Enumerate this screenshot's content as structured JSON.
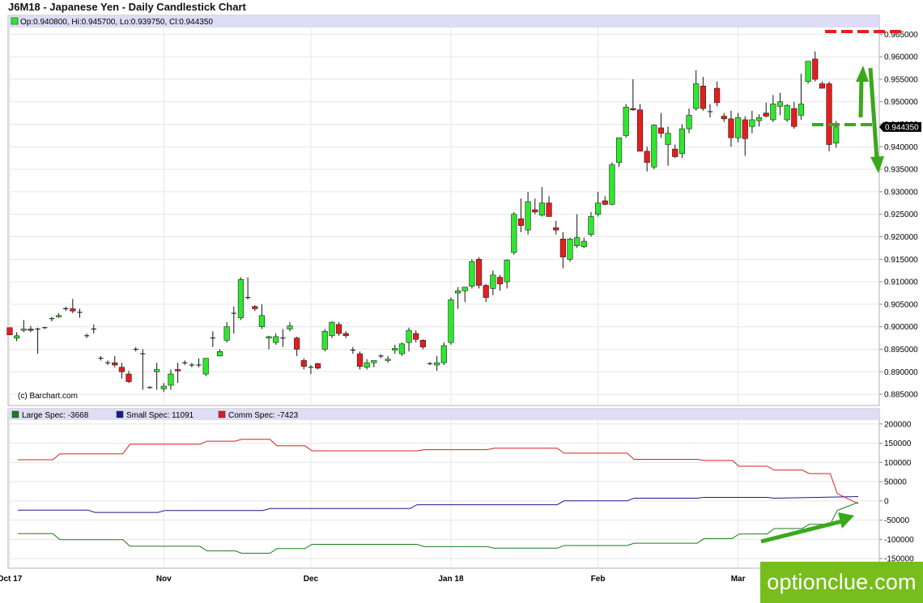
{
  "header": {
    "title": "J6M18 - Japanese Yen - Daily Candlestick Chart",
    "ohlc": "Op:0.940800, Hi:0.945700, Lo:0.939750, Cl:0.944350",
    "credit": "(c) Barchart.com",
    "last_price": "0.944350"
  },
  "watermark": {
    "text": "optionclue.com",
    "color": "#78bd1e"
  },
  "colors": {
    "up": "#2ee82e",
    "down": "#e51d1d",
    "large_spec": "#1c7a1c",
    "small_spec": "#1a1a8c",
    "comm_spec": "#d42020",
    "annotation_green": "#3aa81c",
    "annotation_red": "#e02020"
  },
  "chart_data": [
    {
      "type": "candlestick",
      "title": "J6M18 - Japanese Yen - Daily Candlestick Chart",
      "ylim": [
        0.8825,
        0.9665
      ],
      "yticks": [
        "0.965000",
        "0.960000",
        "0.955000",
        "0.950000",
        "0.945000",
        "0.940000",
        "0.935000",
        "0.930000",
        "0.925000",
        "0.920000",
        "0.915000",
        "0.910000",
        "0.905000",
        "0.900000",
        "0.895000",
        "0.890000",
        "0.885000"
      ],
      "xticks": [
        {
          "label": "Oct 17",
          "i": 0
        },
        {
          "label": "Nov",
          "i": 22
        },
        {
          "label": "Dec",
          "i": 43
        },
        {
          "label": "Jan 18",
          "i": 63
        },
        {
          "label": "Feb",
          "i": 84
        },
        {
          "label": "Mar",
          "i": 104
        }
      ],
      "candles": [
        [
          0.8998,
          0.8998,
          0.8982,
          0.8982
        ],
        [
          0.8975,
          0.8988,
          0.8968,
          0.898
        ],
        [
          0.8992,
          0.9015,
          0.8988,
          0.8995
        ],
        [
          0.8995,
          0.9002,
          0.8988,
          0.8992
        ],
        [
          0.8995,
          0.8998,
          0.894,
          0.8995
        ],
        [
          0.8998,
          0.9,
          0.8995,
          0.8998
        ],
        [
          0.9018,
          0.9022,
          0.9012,
          0.9018
        ],
        [
          0.9022,
          0.903,
          0.902,
          0.9025
        ],
        [
          0.904,
          0.9045,
          0.9035,
          0.9038
        ],
        [
          0.904,
          0.9062,
          0.903,
          0.9035
        ],
        [
          0.9032,
          0.904,
          0.902,
          0.9032
        ],
        [
          0.898,
          0.8985,
          0.8975,
          0.8978
        ],
        [
          0.8995,
          0.9005,
          0.8985,
          0.8995
        ],
        [
          0.893,
          0.8935,
          0.8925,
          0.893
        ],
        [
          0.892,
          0.8925,
          0.8915,
          0.892
        ],
        [
          0.892,
          0.8935,
          0.891,
          0.8915
        ],
        [
          0.891,
          0.892,
          0.8885,
          0.89
        ],
        [
          0.8895,
          0.8902,
          0.8875,
          0.8878
        ],
        [
          0.895,
          0.8955,
          0.8945,
          0.895
        ],
        [
          0.894,
          0.895,
          0.886,
          0.894
        ],
        [
          0.8865,
          0.8868,
          0.8862,
          0.8865
        ],
        [
          0.89,
          0.892,
          0.886,
          0.8905
        ],
        [
          0.8862,
          0.8875,
          0.8855,
          0.8868
        ],
        [
          0.887,
          0.8905,
          0.886,
          0.8895
        ],
        [
          0.8905,
          0.892,
          0.8875,
          0.8902
        ],
        [
          0.892,
          0.8925,
          0.8915,
          0.892
        ],
        [
          0.8915,
          0.892,
          0.891,
          0.8915
        ],
        [
          0.8915,
          0.893,
          0.891,
          0.8915
        ],
        [
          0.8895,
          0.893,
          0.889,
          0.893
        ],
        [
          0.8975,
          0.899,
          0.8955,
          0.8975
        ],
        [
          0.8935,
          0.895,
          0.8935,
          0.8945
        ],
        [
          0.897,
          0.901,
          0.8965,
          0.9
        ],
        [
          0.903,
          0.9045,
          0.8985,
          0.903
        ],
        [
          0.902,
          0.911,
          0.9015,
          0.9105
        ],
        [
          0.9065,
          0.911,
          0.906,
          0.9065
        ],
        [
          0.9045,
          0.9048,
          0.9035,
          0.904
        ],
        [
          0.9,
          0.905,
          0.8995,
          0.9025
        ],
        [
          0.8975,
          0.898,
          0.895,
          0.8978
        ],
        [
          0.8965,
          0.8985,
          0.896,
          0.8978
        ],
        [
          0.8975,
          0.8995,
          0.8955,
          0.8975
        ],
        [
          0.8995,
          0.901,
          0.899,
          0.9002
        ],
        [
          0.8975,
          0.8978,
          0.8935,
          0.895
        ],
        [
          0.8925,
          0.893,
          0.8905,
          0.8912
        ],
        [
          0.891,
          0.8915,
          0.8895,
          0.891
        ],
        [
          0.8918,
          0.892,
          0.8905,
          0.8908
        ],
        [
          0.895,
          0.8995,
          0.8945,
          0.899
        ],
        [
          0.898,
          0.9012,
          0.8975,
          0.901
        ],
        [
          0.9005,
          0.901,
          0.898,
          0.8985
        ],
        [
          0.8985,
          0.899,
          0.8975,
          0.898
        ],
        [
          0.8948,
          0.8955,
          0.894,
          0.8948
        ],
        [
          0.894,
          0.8945,
          0.8905,
          0.8912
        ],
        [
          0.891,
          0.8928,
          0.8905,
          0.892
        ],
        [
          0.892,
          0.8925,
          0.891,
          0.8925
        ],
        [
          0.8935,
          0.8938,
          0.893,
          0.8935
        ],
        [
          0.8925,
          0.8935,
          0.892,
          0.8928
        ],
        [
          0.8948,
          0.896,
          0.894,
          0.8952
        ],
        [
          0.894,
          0.8965,
          0.8935,
          0.8962
        ],
        [
          0.8965,
          0.8998,
          0.8945,
          0.8992
        ],
        [
          0.8985,
          0.8992,
          0.8965,
          0.8972
        ],
        [
          0.897,
          0.8972,
          0.895,
          0.8955
        ],
        [
          0.8918,
          0.8922,
          0.8915,
          0.8918
        ],
        [
          0.8915,
          0.8935,
          0.8902,
          0.892
        ],
        [
          0.892,
          0.8965,
          0.8915,
          0.8958
        ],
        [
          0.8965,
          0.9065,
          0.896,
          0.906
        ],
        [
          0.9075,
          0.9088,
          0.904,
          0.908
        ],
        [
          0.908,
          0.9085,
          0.9055,
          0.9088
        ],
        [
          0.909,
          0.915,
          0.9085,
          0.9145
        ],
        [
          0.915,
          0.9155,
          0.9085,
          0.9092
        ],
        [
          0.9092,
          0.9095,
          0.9055,
          0.9065
        ],
        [
          0.9085,
          0.9125,
          0.907,
          0.9115
        ],
        [
          0.911,
          0.9115,
          0.908,
          0.9095
        ],
        [
          0.91,
          0.915,
          0.9085,
          0.9148
        ],
        [
          0.9165,
          0.9255,
          0.916,
          0.925
        ],
        [
          0.924,
          0.9285,
          0.921,
          0.9225
        ],
        [
          0.9215,
          0.93,
          0.9205,
          0.9278
        ],
        [
          0.926,
          0.9285,
          0.925,
          0.9255
        ],
        [
          0.9248,
          0.931,
          0.9245,
          0.9275
        ],
        [
          0.9275,
          0.929,
          0.9245,
          0.9245
        ],
        [
          0.922,
          0.9235,
          0.9205,
          0.9215
        ],
        [
          0.9195,
          0.921,
          0.913,
          0.9155
        ],
        [
          0.915,
          0.9198,
          0.9145,
          0.9195
        ],
        [
          0.918,
          0.925,
          0.9175,
          0.9198
        ],
        [
          0.9178,
          0.9198,
          0.9175,
          0.919
        ],
        [
          0.9205,
          0.9255,
          0.92,
          0.9245
        ],
        [
          0.925,
          0.93,
          0.9245,
          0.9275
        ],
        [
          0.928,
          0.929,
          0.927,
          0.9272
        ],
        [
          0.9272,
          0.9365,
          0.927,
          0.936
        ],
        [
          0.9365,
          0.942,
          0.9355,
          0.942
        ],
        [
          0.9425,
          0.9495,
          0.942,
          0.9488
        ],
        [
          0.9485,
          0.955,
          0.948,
          0.9482
        ],
        [
          0.9482,
          0.9495,
          0.939,
          0.939
        ],
        [
          0.939,
          0.94,
          0.9345,
          0.9365
        ],
        [
          0.9355,
          0.945,
          0.935,
          0.9448
        ],
        [
          0.9442,
          0.9475,
          0.942,
          0.943
        ],
        [
          0.9405,
          0.9445,
          0.9358,
          0.943
        ],
        [
          0.9395,
          0.9405,
          0.9375,
          0.9378
        ],
        [
          0.9385,
          0.945,
          0.9375,
          0.944
        ],
        [
          0.944,
          0.9485,
          0.943,
          0.947
        ],
        [
          0.9485,
          0.957,
          0.948,
          0.954
        ],
        [
          0.9535,
          0.9555,
          0.948,
          0.9485
        ],
        [
          0.9478,
          0.9495,
          0.9465,
          0.9478
        ],
        [
          0.953,
          0.9545,
          0.949,
          0.9498
        ],
        [
          0.9468,
          0.9475,
          0.9455,
          0.9462
        ],
        [
          0.9462,
          0.948,
          0.94,
          0.942
        ],
        [
          0.942,
          0.9475,
          0.941,
          0.9465
        ],
        [
          0.946,
          0.9468,
          0.938,
          0.9418
        ],
        [
          0.9445,
          0.948,
          0.943,
          0.946
        ],
        [
          0.9458,
          0.9472,
          0.9445,
          0.9465
        ],
        [
          0.9475,
          0.9498,
          0.9465,
          0.9468
        ],
        [
          0.946,
          0.9515,
          0.9455,
          0.9495
        ],
        [
          0.949,
          0.952,
          0.947,
          0.95
        ],
        [
          0.946,
          0.9495,
          0.9455,
          0.9492
        ],
        [
          0.9485,
          0.95,
          0.944,
          0.9445
        ],
        [
          0.947,
          0.9562,
          0.946,
          0.9495
        ],
        [
          0.9545,
          0.9585,
          0.954,
          0.959
        ],
        [
          0.9595,
          0.9612,
          0.9545,
          0.955
        ],
        [
          0.954,
          0.9545,
          0.953,
          0.953
        ],
        [
          0.954,
          0.9545,
          0.939,
          0.9405
        ],
        [
          0.9408,
          0.9457,
          0.9398,
          0.9444
        ]
      ]
    },
    {
      "type": "line",
      "title": "",
      "ylim": [
        -175000,
        210000
      ],
      "yticks": [
        "200000",
        "150000",
        "100000",
        "50000",
        "0",
        "-50000",
        "-100000",
        "-150000"
      ],
      "series": [
        {
          "name": "Large Spec: -3668",
          "color": "#1c7a1c",
          "steps": [
            [
              0,
              -85000
            ],
            [
              5,
              -85000
            ],
            [
              6,
              -101000
            ],
            [
              15,
              -101000
            ],
            [
              16,
              -118000
            ],
            [
              26,
              -118000
            ],
            [
              27,
              -130000
            ],
            [
              31,
              -130000
            ],
            [
              32,
              -136000
            ],
            [
              36,
              -136000
            ],
            [
              37,
              -124000
            ],
            [
              41,
              -124000
            ],
            [
              42,
              -113000
            ],
            [
              57,
              -113000
            ],
            [
              58,
              -119000
            ],
            [
              67,
              -119000
            ],
            [
              68,
              -123000
            ],
            [
              77,
              -123000
            ],
            [
              78,
              -116000
            ],
            [
              87,
              -116000
            ],
            [
              88,
              -110000
            ],
            [
              97,
              -110000
            ],
            [
              98,
              -98000
            ],
            [
              102,
              -98000
            ],
            [
              103,
              -86000
            ],
            [
              107,
              -86000
            ],
            [
              108,
              -72000
            ],
            [
              112,
              -72000
            ],
            [
              113,
              -61000
            ],
            [
              116,
              -61000
            ],
            [
              117,
              -25000
            ],
            [
              120,
              -3668
            ]
          ]
        },
        {
          "name": "Small Spec: 11091",
          "color": "#1a1a8c",
          "steps": [
            [
              0,
              -24000
            ],
            [
              10,
              -24000
            ],
            [
              11,
              -30000
            ],
            [
              20,
              -30000
            ],
            [
              21,
              -25000
            ],
            [
              35,
              -25000
            ],
            [
              36,
              -20000
            ],
            [
              56,
              -20000
            ],
            [
              57,
              -10000
            ],
            [
              77,
              -10000
            ],
            [
              78,
              0
            ],
            [
              87,
              0
            ],
            [
              88,
              7000
            ],
            [
              97,
              7000
            ],
            [
              98,
              9000
            ],
            [
              107,
              9000
            ],
            [
              108,
              7000
            ],
            [
              120,
              11091
            ]
          ]
        },
        {
          "name": "Comm Spec: -7423",
          "color": "#d42020",
          "steps": [
            [
              0,
              107000
            ],
            [
              5,
              107000
            ],
            [
              6,
              122000
            ],
            [
              15,
              122000
            ],
            [
              16,
              147000
            ],
            [
              26,
              147000
            ],
            [
              27,
              155000
            ],
            [
              31,
              155000
            ],
            [
              32,
              160000
            ],
            [
              36,
              160000
            ],
            [
              37,
              143000
            ],
            [
              41,
              143000
            ],
            [
              42,
              130000
            ],
            [
              57,
              130000
            ],
            [
              58,
              133000
            ],
            [
              67,
              133000
            ],
            [
              68,
              137000
            ],
            [
              77,
              137000
            ],
            [
              78,
              124000
            ],
            [
              87,
              124000
            ],
            [
              88,
              108000
            ],
            [
              97,
              108000
            ],
            [
              98,
              105000
            ],
            [
              102,
              105000
            ],
            [
              103,
              90000
            ],
            [
              107,
              90000
            ],
            [
              108,
              80000
            ],
            [
              112,
              80000
            ],
            [
              113,
              71000
            ],
            [
              116,
              71000
            ],
            [
              117,
              19000
            ],
            [
              120,
              -7423
            ]
          ]
        }
      ]
    }
  ]
}
